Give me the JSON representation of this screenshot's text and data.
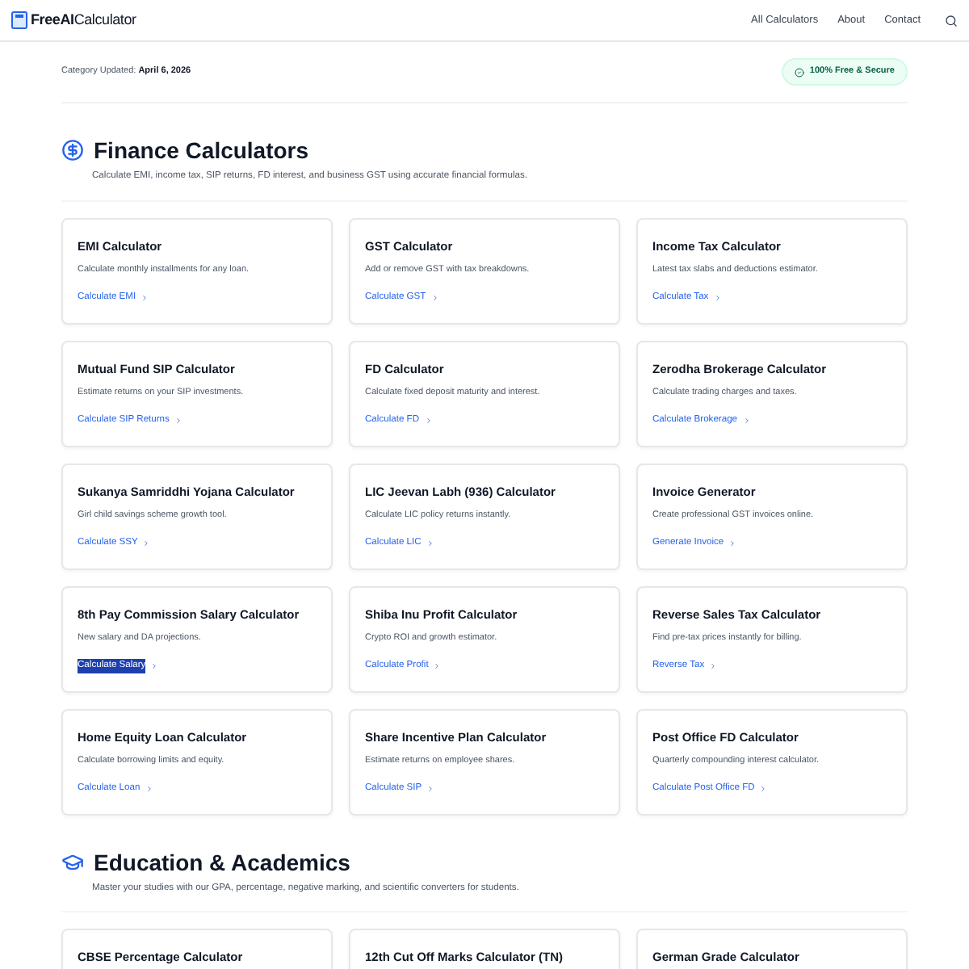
{
  "header": {
    "logo_bold": "FreeAI",
    "logo_rest": "Calculator",
    "nav": [
      "All Calculators",
      "About",
      "Contact"
    ]
  },
  "meta": {
    "label": "Category Updated:",
    "date": "April 6, 2026",
    "badge": "100% Free & Secure"
  },
  "sections": [
    {
      "kind": "finance",
      "title": "Finance Calculators",
      "description": "Calculate EMI, income tax, SIP returns, FD interest, and business GST using accurate financial formulas.",
      "cards": [
        {
          "title": "EMI Calculator",
          "description": "Calculate monthly installments for any loan.",
          "link": "Calculate EMI",
          "highlighted": false
        },
        {
          "title": "GST Calculator",
          "description": "Add or remove GST with tax breakdowns.",
          "link": "Calculate GST",
          "highlighted": false
        },
        {
          "title": "Income Tax Calculator",
          "description": "Latest tax slabs and deductions estimator.",
          "link": "Calculate Tax",
          "highlighted": false
        },
        {
          "title": "Mutual Fund SIP Calculator",
          "description": "Estimate returns on your SIP investments.",
          "link": "Calculate SIP Returns",
          "highlighted": false
        },
        {
          "title": "FD Calculator",
          "description": "Calculate fixed deposit maturity and interest.",
          "link": "Calculate FD",
          "highlighted": false
        },
        {
          "title": "Zerodha Brokerage Calculator",
          "description": "Calculate trading charges and taxes.",
          "link": "Calculate Brokerage",
          "highlighted": false
        },
        {
          "title": "Sukanya Samriddhi Yojana Calculator",
          "description": "Girl child savings scheme growth tool.",
          "link": "Calculate SSY",
          "highlighted": false
        },
        {
          "title": "LIC Jeevan Labh (936) Calculator",
          "description": "Calculate LIC policy returns instantly.",
          "link": "Calculate LIC",
          "highlighted": false
        },
        {
          "title": "Invoice Generator",
          "description": "Create professional GST invoices online.",
          "link": "Generate Invoice",
          "highlighted": false
        },
        {
          "title": "8th Pay Commission Salary Calculator",
          "description": "New salary and DA projections.",
          "link": "Calculate Salary",
          "highlighted": true
        },
        {
          "title": "Shiba Inu Profit Calculator",
          "description": "Crypto ROI and growth estimator.",
          "link": "Calculate Profit",
          "highlighted": false
        },
        {
          "title": "Reverse Sales Tax Calculator",
          "description": "Find pre-tax prices instantly for billing.",
          "link": "Reverse Tax",
          "highlighted": false
        },
        {
          "title": "Home Equity Loan Calculator",
          "description": "Calculate borrowing limits and equity.",
          "link": "Calculate Loan",
          "highlighted": false
        },
        {
          "title": "Share Incentive Plan Calculator",
          "description": "Estimate returns on employee shares.",
          "link": "Calculate SIP",
          "highlighted": false
        },
        {
          "title": "Post Office FD Calculator",
          "description": "Quarterly compounding interest calculator.",
          "link": "Calculate Post Office FD",
          "highlighted": false
        }
      ]
    },
    {
      "kind": "education",
      "title": "Education & Academics",
      "description": "Master your studies with our GPA, percentage, negative marking, and scientific converters for students.",
      "cards": [
        {
          "title": "CBSE Percentage Calculator"
        },
        {
          "title": "12th Cut Off Marks Calculator (TN)"
        },
        {
          "title": "German Grade Calculator"
        }
      ]
    }
  ]
}
